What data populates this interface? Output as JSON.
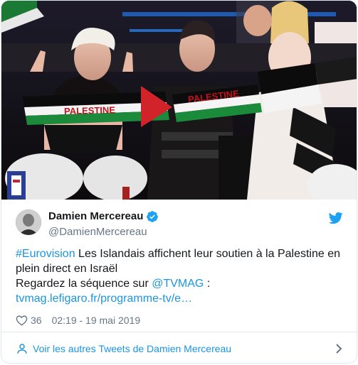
{
  "tweet": {
    "author": {
      "display_name": "Damien Mercereau",
      "handle": "@DamienMercereau",
      "verified_icon": "verified-badge-icon",
      "avatar": "avatar"
    },
    "text": {
      "hashtag": "#Eurovision",
      "line1_rest": " Les Islandais affichent leur soutien à la Palestine en",
      "line2": "plein direct en Israël",
      "line3_prefix": "Regardez la séquence sur ",
      "mention": "@TVMAG",
      "line3_suffix": " :",
      "link": "tvmag.lefigaro.fr/programme-tv/e…"
    },
    "likes": "36",
    "timestamp": "02:19 - 19 mai 2019",
    "footer_link": "Voir les autres Tweets de Damien Mercereau"
  },
  "photo": {
    "banner_left": "PALESTINE",
    "banner_right": "PALESTINE"
  },
  "colors": {
    "link": "#1b95e0",
    "twitter_blue": "#1da1f2",
    "text": "#14171a",
    "muted": "#657786",
    "border": "#e1e8ed"
  },
  "icons": [
    "twitter-bird-icon",
    "heart-icon",
    "verified-badge-icon",
    "user-icon",
    "chevron-right-icon"
  ]
}
